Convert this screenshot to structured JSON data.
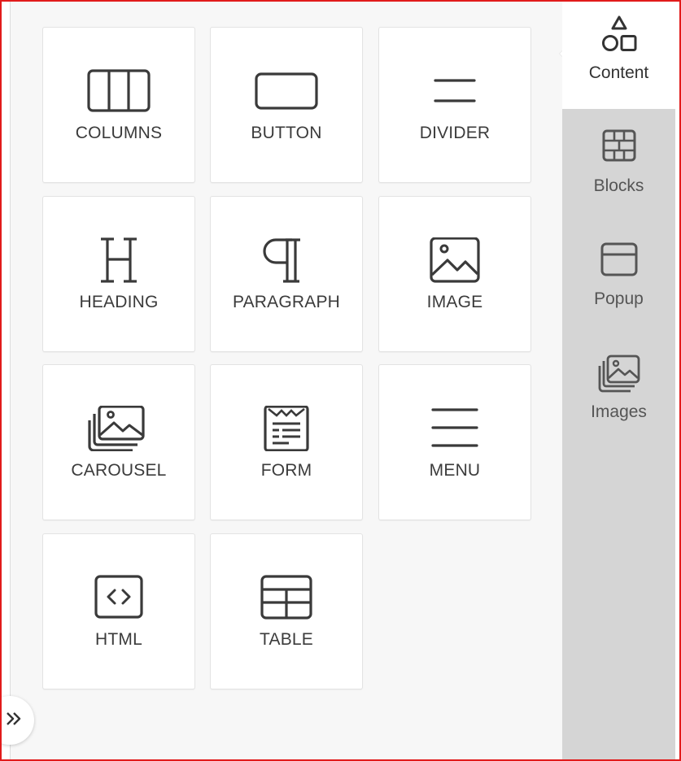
{
  "tools": [
    {
      "label": "COLUMNS",
      "icon": "columns-icon"
    },
    {
      "label": "BUTTON",
      "icon": "button-icon"
    },
    {
      "label": "DIVIDER",
      "icon": "divider-icon"
    },
    {
      "label": "HEADING",
      "icon": "heading-icon"
    },
    {
      "label": "PARAGRAPH",
      "icon": "paragraph-icon"
    },
    {
      "label": "IMAGE",
      "icon": "image-icon"
    },
    {
      "label": "CAROUSEL",
      "icon": "carousel-icon"
    },
    {
      "label": "FORM",
      "icon": "form-icon"
    },
    {
      "label": "MENU",
      "icon": "menu-icon"
    },
    {
      "label": "HTML",
      "icon": "html-icon"
    },
    {
      "label": "TABLE",
      "icon": "table-icon"
    }
  ],
  "sidebar": {
    "items": [
      {
        "label": "Content",
        "icon": "shapes-icon",
        "active": true
      },
      {
        "label": "Blocks",
        "icon": "blocks-icon",
        "active": false
      },
      {
        "label": "Popup",
        "icon": "popup-icon",
        "active": false
      },
      {
        "label": "Images",
        "icon": "images-icon",
        "active": false
      }
    ]
  },
  "expand_button": {
    "icon": "double-chevron-right-icon"
  },
  "colors": {
    "frame": "#e11b1b",
    "panel_bg": "#f7f7f7",
    "sidebar_bg": "#d5d5d5",
    "tile_bg": "#ffffff",
    "text": "#3b3b3b"
  }
}
